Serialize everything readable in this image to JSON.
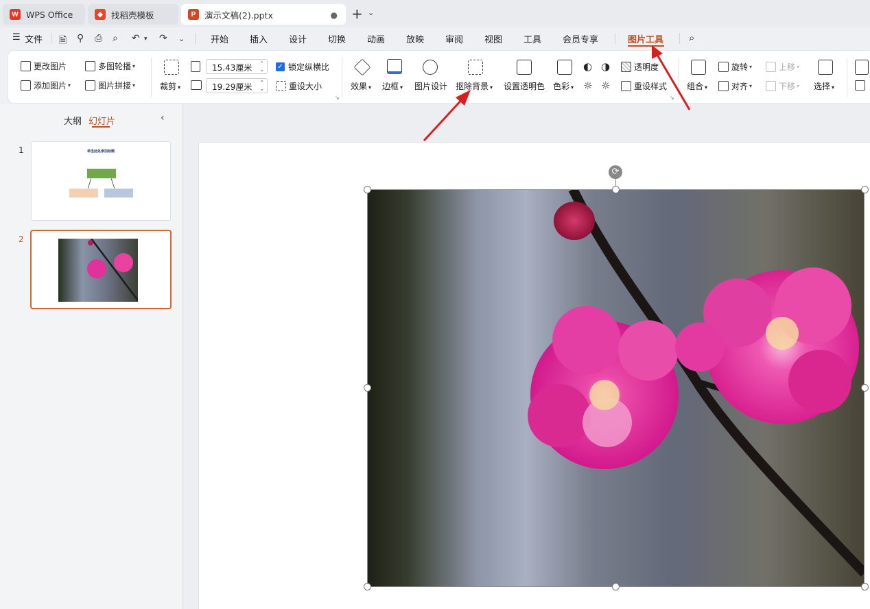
{
  "tabs": [
    {
      "label": "WPS Office",
      "icon": "wps-logo-icon"
    },
    {
      "label": "找稻壳模板",
      "icon": "docer-icon"
    },
    {
      "label": "演示文稿(2).pptx",
      "icon": "presentation-file-icon",
      "icon_letter": "P"
    }
  ],
  "menubar": {
    "file_label": "文件",
    "items": [
      "开始",
      "插入",
      "设计",
      "切换",
      "动画",
      "放映",
      "审阅",
      "视图",
      "工具",
      "会员专享",
      "图片工具"
    ],
    "active": "图片工具"
  },
  "ribbon": {
    "change_picture": "更改图片",
    "add_picture": "添加图片",
    "multi_carousel": "多图轮播",
    "picture_collage": "图片拼接",
    "crop": "裁剪",
    "height_value": "15.43厘米",
    "width_value": "19.29厘米",
    "lock_ratio": "锁定纵横比",
    "reset_size": "重设大小",
    "effects": "效果",
    "border": "边框",
    "picture_design": "图片设计",
    "remove_background": "抠除背景",
    "set_transparent_color": "设置透明色",
    "color": "色彩",
    "transparency": "透明度",
    "reset_style": "重设样式",
    "rotate": "旋转",
    "group": "组合",
    "align": "对齐",
    "bring_forward": "上移",
    "send_backward": "下移",
    "select": "选择"
  },
  "left_panel": {
    "tab_outline": "大纲",
    "tab_slides": "幻灯片",
    "slides": [
      {
        "number": "1",
        "title": "单击此处添加标题"
      },
      {
        "number": "2"
      }
    ]
  },
  "colors": {
    "accent": "#c0501f",
    "arrow": "#d42020"
  }
}
